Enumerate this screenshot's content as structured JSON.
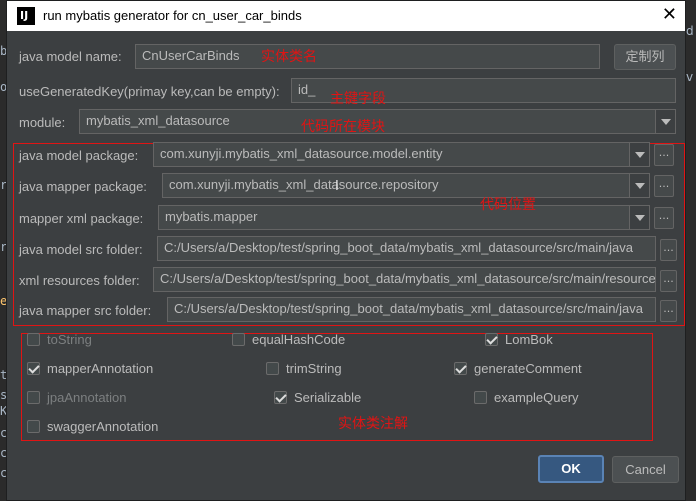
{
  "window": {
    "title": "run mybatis generator for cn_user_car_binds",
    "app_icon": "IJ"
  },
  "form": {
    "java_model_name": {
      "label": "java model name:",
      "value": "CnUserCarBinds"
    },
    "custom_columns_button": "定制列",
    "use_generated_key": {
      "label": "useGeneratedKey(primay key,can be empty):",
      "value": "id_"
    },
    "module": {
      "label": "module:",
      "value": "mybatis_xml_datasource"
    },
    "java_model_package": {
      "label": "java model package:",
      "value": "com.xunyji.mybatis_xml_datasource.model.entity"
    },
    "java_mapper_package": {
      "label": "java mapper package:",
      "value": "com.xunyji.mybatis_xml_datasource.repository"
    },
    "mapper_xml_package": {
      "label": "mapper xml package:",
      "value": "mybatis.mapper"
    },
    "java_model_src_folder": {
      "label": "java model src folder:",
      "value": "C:/Users/a/Desktop/test/spring_boot_data/mybatis_xml_datasource/src/main/java"
    },
    "xml_resources_folder": {
      "label": "xml resources folder:",
      "value": "C:/Users/a/Desktop/test/spring_boot_data/mybatis_xml_datasource/src/main/resources"
    },
    "java_mapper_src_folder": {
      "label": "java mapper src folder:",
      "value": "C:/Users/a/Desktop/test/spring_boot_data/mybatis_xml_datasource/src/main/java"
    },
    "browse_label": "..."
  },
  "options": {
    "toString": {
      "label": "toString",
      "checked": false,
      "enabled": false
    },
    "equalHashCode": {
      "label": "equalHashCode",
      "checked": false,
      "enabled": true
    },
    "lombok": {
      "label": "LomBok",
      "checked": true,
      "enabled": true
    },
    "mapperAnnotation": {
      "label": "mapperAnnotation",
      "checked": true,
      "enabled": true
    },
    "trimString": {
      "label": "trimString",
      "checked": false,
      "enabled": true
    },
    "generateComment": {
      "label": "generateComment",
      "checked": true,
      "enabled": true
    },
    "jpaAnnotation": {
      "label": "jpaAnnotation",
      "checked": false,
      "enabled": false
    },
    "serializable": {
      "label": "Serializable",
      "checked": true,
      "enabled": true
    },
    "exampleQuery": {
      "label": "exampleQuery",
      "checked": false,
      "enabled": true
    },
    "swaggerAnnotation": {
      "label": "swaggerAnnotation",
      "checked": false,
      "enabled": true
    }
  },
  "annotations": {
    "entity_name": "实体类名",
    "primary_key": "主键字段",
    "module_location": "代码所在模块",
    "code_location": "代码位置",
    "entity_annotations": "实体类注解"
  },
  "buttons": {
    "ok": "OK",
    "cancel": "Cancel"
  },
  "colors": {
    "annotation_red": "#e01414",
    "dialog_bg": "#3c3f41",
    "ok_blue": "#365880"
  },
  "background_editor": {
    "left_glyphs": [
      "b",
      "o",
      "r",
      "r",
      "e",
      "t",
      "s",
      "K",
      "c",
      "c",
      "c"
    ],
    "right_glyphs": [
      "d",
      "v"
    ]
  }
}
